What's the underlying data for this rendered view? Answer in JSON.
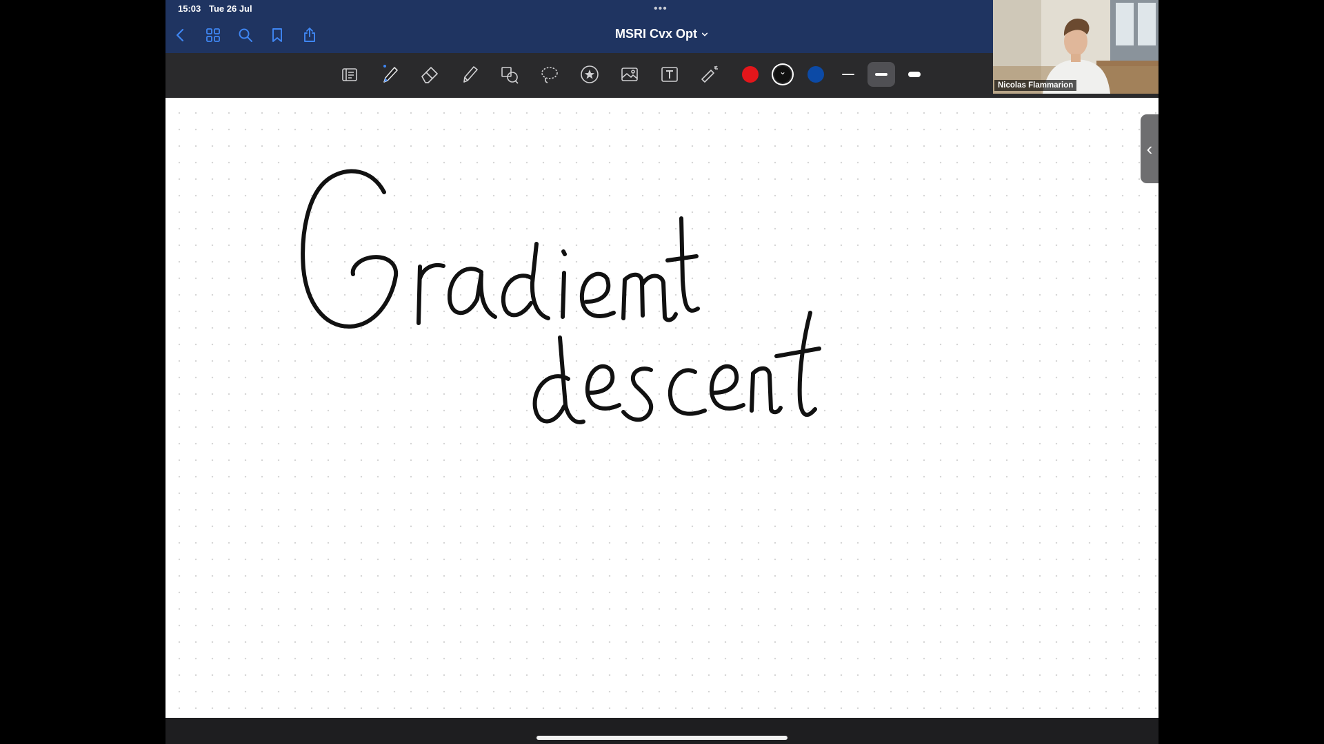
{
  "status_bar": {
    "time": "15:03",
    "date": "Tue 26 Jul"
  },
  "document": {
    "title": "MSRI Cvx Opt"
  },
  "nav_icons": [
    "back-chevron-icon",
    "grid-icon",
    "search-icon",
    "bookmark-icon",
    "share-icon"
  ],
  "tools": [
    "document-icon",
    "pen-icon",
    "eraser-icon",
    "highlighter-icon",
    "shapes-icon",
    "lasso-icon",
    "sticker-icon",
    "image-icon",
    "textbox-icon",
    "laser-pointer-icon"
  ],
  "pen_colors": [
    "#e3161b",
    "#111111",
    "#0c4aa6"
  ],
  "selected_color_index": 1,
  "stroke_widths": [
    "thin",
    "medium",
    "thick"
  ],
  "selected_stroke_index": 1,
  "canvas": {
    "handwritten_lines": [
      "Gradient",
      "descent"
    ],
    "ink_color": "#111111"
  },
  "video": {
    "participant_name": "Nicolas Flammarion"
  }
}
